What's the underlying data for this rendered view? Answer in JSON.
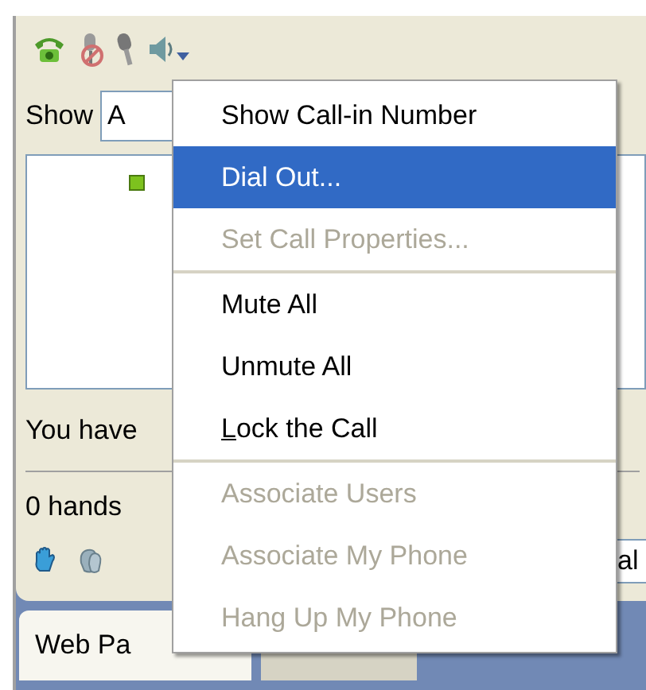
{
  "toolbar": {
    "has_dropdown": true
  },
  "show": {
    "label": "Show",
    "value": "A"
  },
  "participants": [
    {
      "online": true
    }
  ],
  "status": {
    "text": "You have"
  },
  "hands": {
    "count": "0 hands",
    "field_value": "al"
  },
  "tabs": [
    {
      "label": "Web Pa",
      "selected": true
    },
    {
      "selected": false
    }
  ],
  "menu": {
    "groups": [
      [
        {
          "label": "Show Call-in Number",
          "disabled": false,
          "selected": false,
          "mnemonic_first": false
        },
        {
          "label": "Dial Out...",
          "disabled": false,
          "selected": true,
          "mnemonic_first": false
        },
        {
          "label": "Set Call Properties...",
          "disabled": true,
          "selected": false,
          "mnemonic_first": false
        }
      ],
      [
        {
          "label": "Mute All",
          "disabled": false,
          "selected": false,
          "mnemonic_first": false
        },
        {
          "label": "Unmute All",
          "disabled": false,
          "selected": false,
          "mnemonic_first": false
        },
        {
          "label": "Lock the Call",
          "disabled": false,
          "selected": false,
          "mnemonic_first": true
        }
      ],
      [
        {
          "label": "Associate Users",
          "disabled": true,
          "selected": false,
          "mnemonic_first": false
        },
        {
          "label": "Associate My Phone",
          "disabled": true,
          "selected": false,
          "mnemonic_first": false
        },
        {
          "label": "Hang Up My Phone",
          "disabled": true,
          "selected": false,
          "mnemonic_first": false
        }
      ]
    ]
  }
}
